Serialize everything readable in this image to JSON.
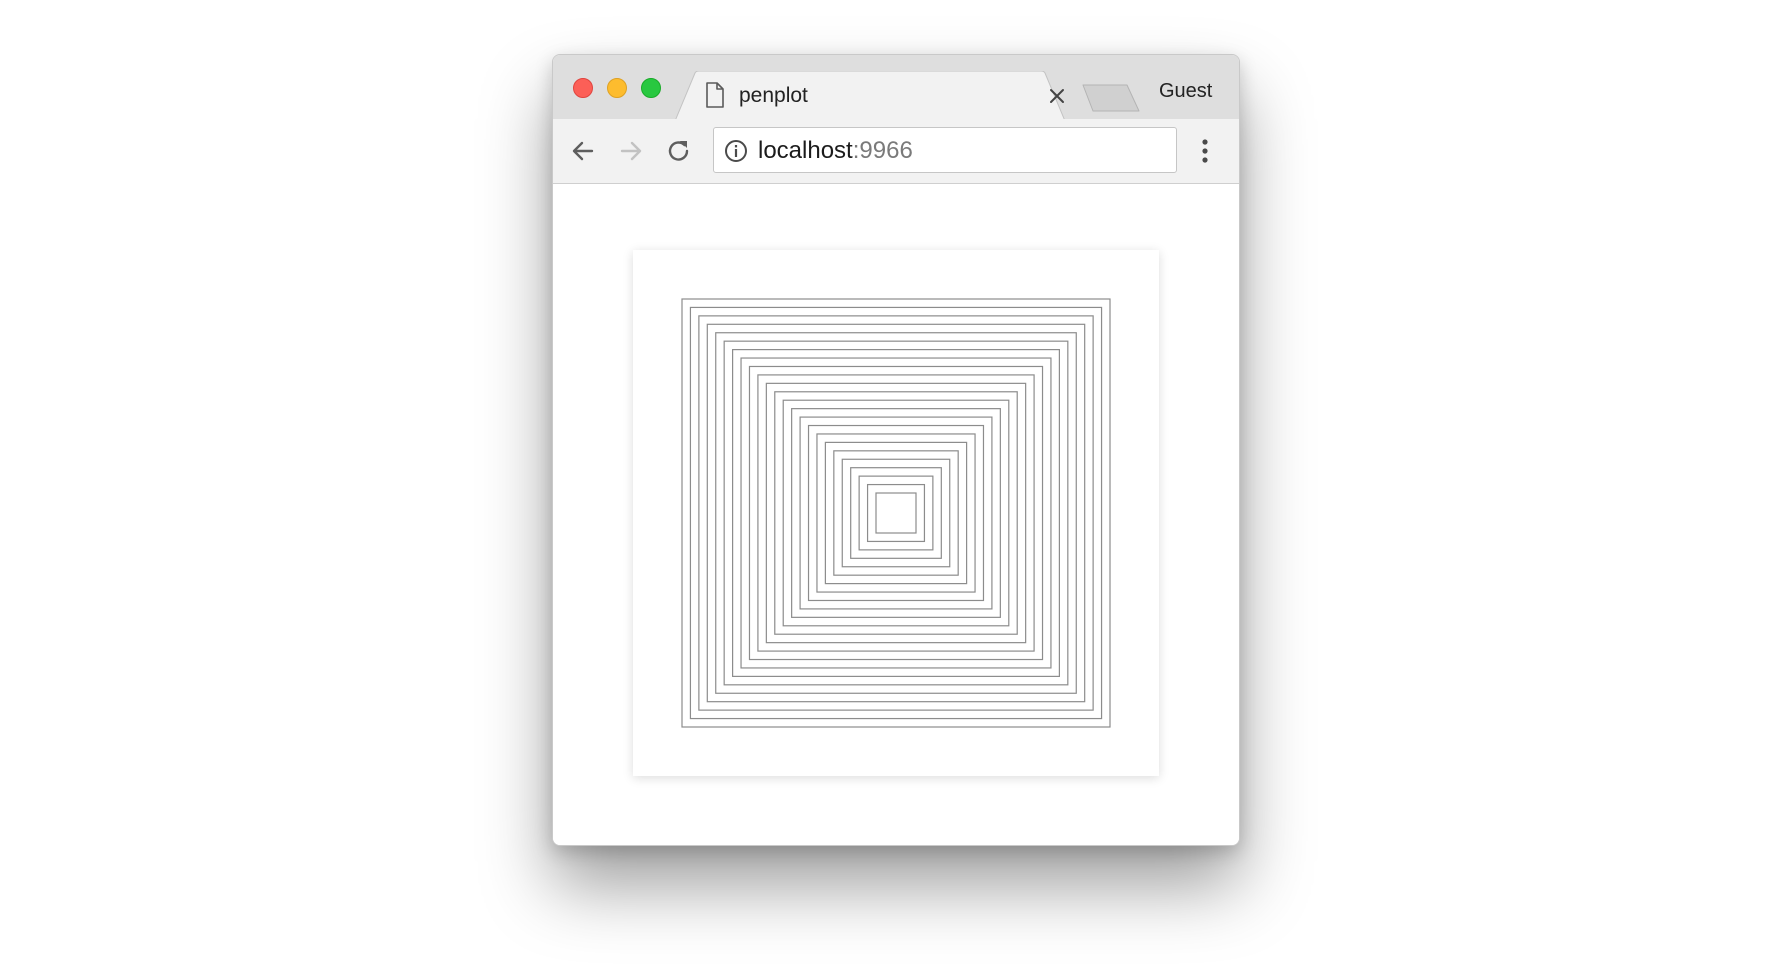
{
  "window": {
    "controls": [
      "close",
      "minimize",
      "maximize"
    ]
  },
  "tab": {
    "title": "penplot",
    "icon": "document-icon",
    "close_icon": "close-icon"
  },
  "profile": {
    "label": "Guest"
  },
  "toolbar": {
    "back_icon": "arrow-left-icon",
    "forward_icon": "arrow-right-icon",
    "reload_icon": "reload-icon",
    "menu_icon": "kebab-menu-icon"
  },
  "address_bar": {
    "info_icon": "info-icon",
    "host": "localhost",
    "port": ":9966"
  },
  "page": {
    "artwork": "concentric-squares",
    "square_count": 24,
    "stroke_color": "#8c8c8c",
    "background_color": "#ffffff"
  },
  "colors": {
    "titlebar": "#dedede",
    "toolbar": "#f2f2f2",
    "close": "#fc5f57",
    "minimize": "#fdbc2e",
    "maximize": "#28c840"
  }
}
